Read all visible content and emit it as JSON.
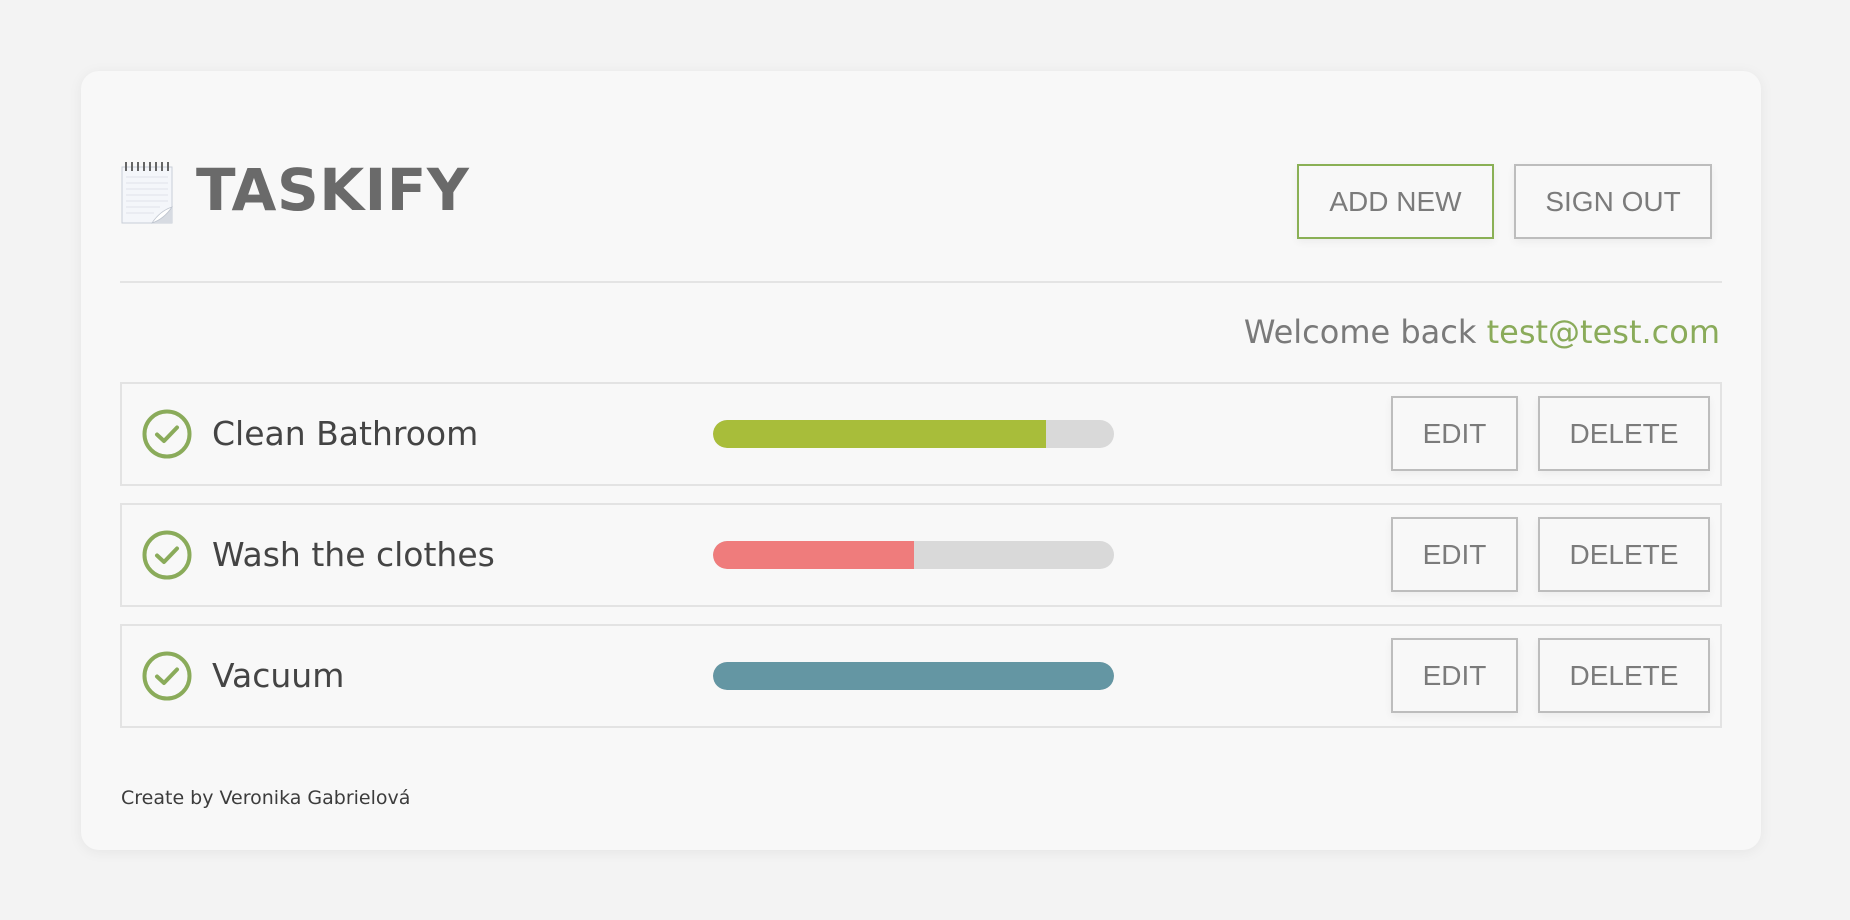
{
  "app": {
    "title": "TASKIFY",
    "icon": "notepad-icon"
  },
  "header": {
    "add_new_label": "ADD NEW",
    "sign_out_label": "SIGN OUT"
  },
  "welcome": {
    "prefix": "Welcome back",
    "email": "test@test.com"
  },
  "tasks": [
    {
      "name": "Clean Bathroom",
      "progress_percent": 83,
      "color": "#a8bd3a",
      "edit_label": "EDIT",
      "delete_label": "DELETE"
    },
    {
      "name": "Wash the clothes",
      "progress_percent": 50,
      "color": "#ef7c7c",
      "edit_label": "EDIT",
      "delete_label": "DELETE"
    },
    {
      "name": "Vacuum",
      "progress_percent": 100,
      "color": "#6496a3",
      "edit_label": "EDIT",
      "delete_label": "DELETE"
    }
  ],
  "footer": {
    "credit": "Create by Veronika Gabrielová"
  },
  "colors": {
    "accent": "#8aab5a",
    "check": "#8aab5a",
    "bar_track": "#d9d9d9"
  }
}
